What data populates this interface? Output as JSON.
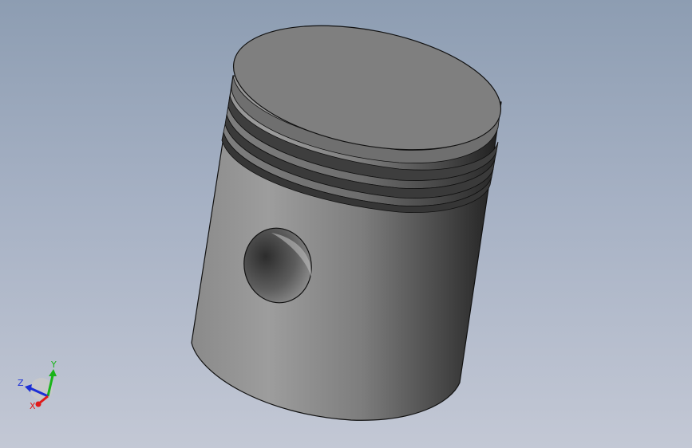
{
  "viewport": {
    "model_name": "piston",
    "background_top": "#8d9db2",
    "background_bottom": "#c3c8d5"
  },
  "model": {
    "body_color_light": "#9a9a9a",
    "body_color_dark": "#262626",
    "crown_color": "#7f7f7f",
    "ring_grooves": 3,
    "features": [
      "crown",
      "ring-grooves",
      "skirt",
      "wrist-pin-bore"
    ]
  },
  "triad": {
    "x_label": "X",
    "y_label": "Y",
    "z_label": "Z",
    "x_color": "#e01a1a",
    "y_color": "#19b419",
    "z_color": "#1c2fd6"
  }
}
